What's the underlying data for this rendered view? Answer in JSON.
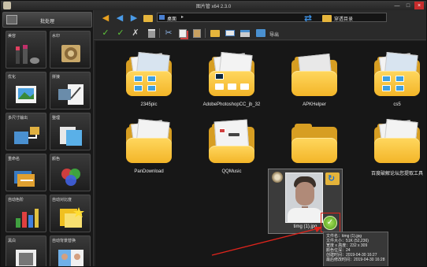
{
  "window": {
    "title": "图片管 x64 2.3.0",
    "controls": [
      "—",
      "□",
      "×"
    ]
  },
  "sidebar": {
    "header_label": "批处理",
    "tools": [
      {
        "label": "美容"
      },
      {
        "label": "水印"
      },
      {
        "label": "优化"
      },
      {
        "label": "拼接"
      },
      {
        "label": "多尺寸输出"
      },
      {
        "label": "整理"
      },
      {
        "label": "重命名"
      },
      {
        "label": "颜色"
      },
      {
        "label": "自动色阶"
      },
      {
        "label": "自动对比度"
      },
      {
        "label": "黑白"
      },
      {
        "label": "自动背景替换"
      }
    ]
  },
  "navbar": {
    "path_label": "桌面",
    "path_chevron": "▸",
    "browse_label": "穿透目录"
  },
  "actionbar": {
    "export_label": "导出"
  },
  "folders": [
    {
      "name": "2345pic"
    },
    {
      "name": "AdobePhotoshopCC_jb_32"
    },
    {
      "name": "APKHelper"
    },
    {
      "name": "cs5"
    },
    {
      "name": "PanDownload"
    },
    {
      "name": "QQMusic"
    },
    {
      "name": "上传图片"
    },
    {
      "name": "百度破解论坛您提取工具"
    }
  ],
  "image_item": {
    "name": "timg (1).jpg",
    "check": "✓",
    "tooltip": [
      "文件名：timg (1).jpg",
      "文件大小：51K (52,236)",
      "宽度 x 高度：232 x 309",
      "颜色位深：24",
      "创建时间：2019-04-30 16:27",
      "最后修改时间：2019-04-30 16:28"
    ]
  },
  "colors": {
    "background": "#171717",
    "folder_yellow": "#f3b528",
    "highlight_red": "#e0241c",
    "accent_blue": "#3d8fe0"
  }
}
